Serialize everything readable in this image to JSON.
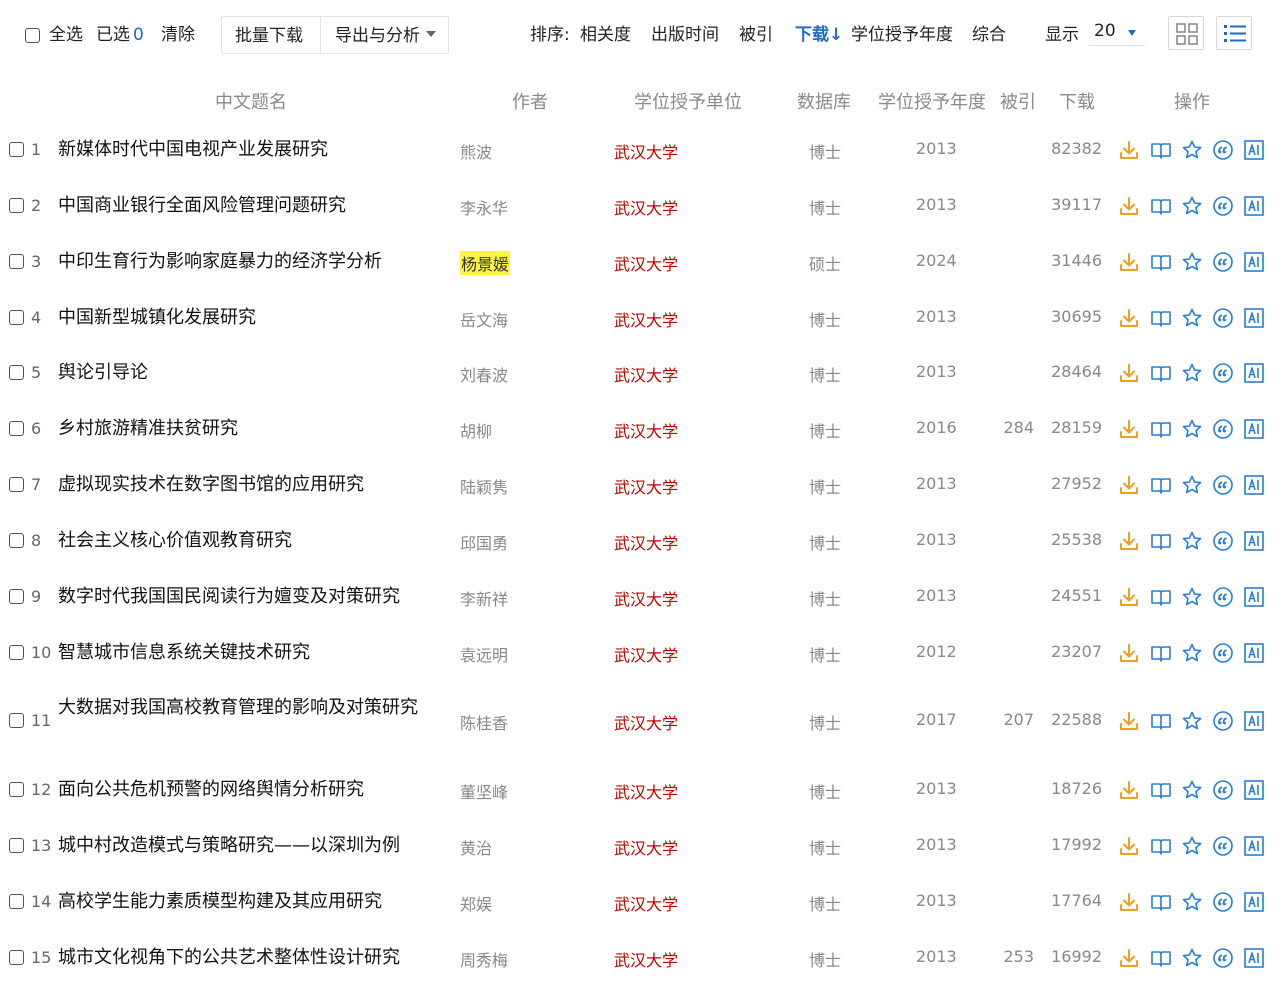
{
  "toolbar": {
    "select_all": "全选",
    "selected_label": "已选",
    "selected_count": "0",
    "clear": "清除",
    "batch_download": "批量下载",
    "export_analysis": "导出与分析",
    "sort_label": "排序:",
    "sort_options": [
      "相关度",
      "出版时间",
      "被引",
      "下载",
      "学位授予年度",
      "综合"
    ],
    "sort_active_index": 3,
    "sort_active_arrow": "↓",
    "display_label": "显示",
    "page_size": "20"
  },
  "columns": [
    "中文题名",
    "作者",
    "学位授予单位",
    "数据库",
    "学位授予年度",
    "被引",
    "下载",
    "操作"
  ],
  "rows": [
    {
      "no": "1",
      "title": "新媒体时代中国电视产业发展研究",
      "author": "熊波",
      "unit": "武汉大学",
      "db": "博士",
      "year": "2013",
      "cite": "",
      "downloads": "82382"
    },
    {
      "no": "2",
      "title": "中国商业银行全面风险管理问题研究",
      "author": "李永华",
      "unit": "武汉大学",
      "db": "博士",
      "year": "2013",
      "cite": "",
      "downloads": "39117"
    },
    {
      "no": "3",
      "title": "中印生育行为影响家庭暴力的经济学分析",
      "author": "杨景媛",
      "unit": "武汉大学",
      "db": "硕士",
      "year": "2024",
      "cite": "",
      "downloads": "31446",
      "highlight": true
    },
    {
      "no": "4",
      "title": "中国新型城镇化发展研究",
      "author": "岳文海",
      "unit": "武汉大学",
      "db": "博士",
      "year": "2013",
      "cite": "",
      "downloads": "30695"
    },
    {
      "no": "5",
      "title": "舆论引导论",
      "author": "刘春波",
      "unit": "武汉大学",
      "db": "博士",
      "year": "2013",
      "cite": "",
      "downloads": "28464"
    },
    {
      "no": "6",
      "title": "乡村旅游精准扶贫研究",
      "author": "胡柳",
      "unit": "武汉大学",
      "db": "博士",
      "year": "2016",
      "cite": "284",
      "downloads": "28159"
    },
    {
      "no": "7",
      "title": "虚拟现实技术在数字图书馆的应用研究",
      "author": "陆颖隽",
      "unit": "武汉大学",
      "db": "博士",
      "year": "2013",
      "cite": "",
      "downloads": "27952"
    },
    {
      "no": "8",
      "title": "社会主义核心价值观教育研究",
      "author": "邱国勇",
      "unit": "武汉大学",
      "db": "博士",
      "year": "2013",
      "cite": "",
      "downloads": "25538"
    },
    {
      "no": "9",
      "title": "数字时代我国国民阅读行为嬗变及对策研究",
      "author": "李新祥",
      "unit": "武汉大学",
      "db": "博士",
      "year": "2013",
      "cite": "",
      "downloads": "24551"
    },
    {
      "no": "10",
      "title": "智慧城市信息系统关键技术研究",
      "author": "袁远明",
      "unit": "武汉大学",
      "db": "博士",
      "year": "2012",
      "cite": "",
      "downloads": "23207"
    },
    {
      "no": "11",
      "title": "大数据对我国高校教育管理的影响及对策研究",
      "author": "陈桂香",
      "unit": "武汉大学",
      "db": "博士",
      "year": "2017",
      "cite": "207",
      "downloads": "22588"
    },
    {
      "no": "12",
      "title": "面向公共危机预警的网络舆情分析研究",
      "author": "董坚峰",
      "unit": "武汉大学",
      "db": "博士",
      "year": "2013",
      "cite": "",
      "downloads": "18726"
    },
    {
      "no": "13",
      "title": "城中村改造模式与策略研究——以深圳为例",
      "author": "黄治",
      "unit": "武汉大学",
      "db": "博士",
      "year": "2013",
      "cite": "",
      "downloads": "17992"
    },
    {
      "no": "14",
      "title": "高校学生能力素质模型构建及其应用研究",
      "author": "郑娱",
      "unit": "武汉大学",
      "db": "博士",
      "year": "2013",
      "cite": "",
      "downloads": "17764"
    },
    {
      "no": "15",
      "title": "城市文化视角下的公共艺术整体性设计研究",
      "author": "周秀梅",
      "unit": "武汉大学",
      "db": "博士",
      "year": "2013",
      "cite": "253",
      "downloads": "16992"
    }
  ],
  "row_actions": [
    "download-icon",
    "read-book-icon",
    "favorite-star-icon",
    "cite-quote-icon",
    "ai-assistant-icon"
  ],
  "colors": {
    "accent": "#1f6cc5",
    "unit_red": "#c40000",
    "action_orange": "#f0a020",
    "action_blue": "#2a7fd4",
    "highlight": "#fff53a"
  }
}
